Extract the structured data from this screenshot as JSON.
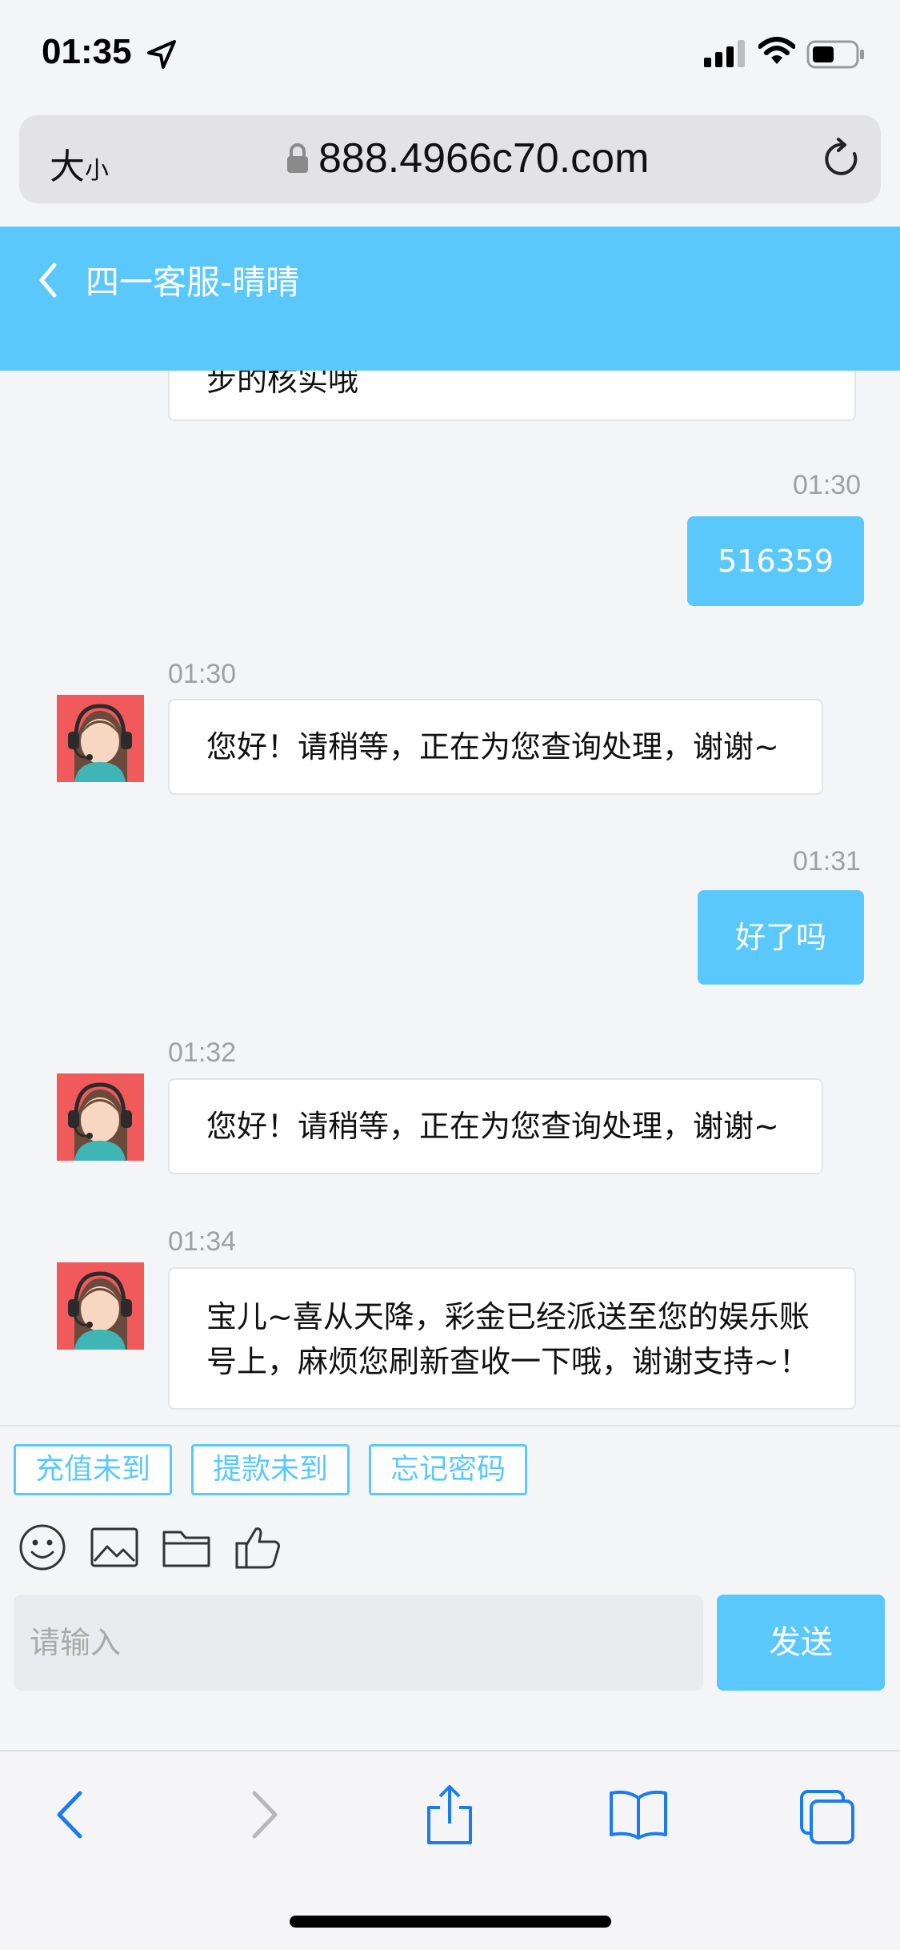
{
  "status_bar": {
    "time": "01:35"
  },
  "browser": {
    "text_size_big": "大",
    "text_size_small": "小",
    "url": "888.4966c70.com"
  },
  "chat": {
    "title": "四一客服-晴晴",
    "partial_message": "步的核实哦",
    "messages": [
      {
        "from": "user",
        "time": "01:30",
        "text": "516359"
      },
      {
        "from": "agent",
        "time": "01:30",
        "text": "您好！请稍等，正在为您查询处理，谢谢~"
      },
      {
        "from": "user",
        "time": "01:31",
        "text": "好了吗"
      },
      {
        "from": "agent",
        "time": "01:32",
        "text": "您好！请稍等，正在为您查询处理，谢谢~"
      },
      {
        "from": "agent",
        "time": "01:34",
        "text": "宝儿~喜从天降，彩金已经派送至您的娱乐账号上，麻烦您刷新查收一下哦，谢谢支持~！"
      }
    ]
  },
  "composer": {
    "quick_replies": [
      "充值未到",
      "提款未到",
      "忘记密码"
    ],
    "tools": [
      "emoji-icon",
      "image-icon",
      "folder-icon",
      "thumbs-up-icon"
    ],
    "input_placeholder": "请输入",
    "send_label": "发送"
  },
  "colors": {
    "accent": "#5bc8fb",
    "avatar_bg": "#f05a5a",
    "toolbar_blue": "#1a7cf0"
  }
}
